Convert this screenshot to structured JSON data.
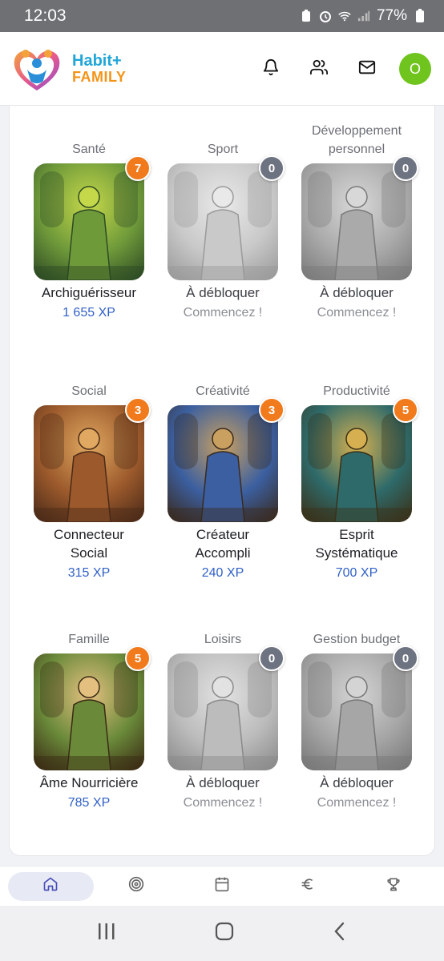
{
  "status_bar": {
    "time": "12:03",
    "battery": "77%"
  },
  "brand": {
    "top": "Habit+",
    "bottom": "FAMILY"
  },
  "user": {
    "avatar_initial": "O"
  },
  "categories": [
    {
      "category": "Santé",
      "title": "Archiguérisseur",
      "badge": "7",
      "xp": "1 655 XP",
      "cta": "",
      "locked": false
    },
    {
      "category": "Sport",
      "title": "À débloquer",
      "badge": "0",
      "xp": "",
      "cta": "Commencez !",
      "locked": true
    },
    {
      "category": "Développement personnel",
      "title": "À débloquer",
      "badge": "0",
      "xp": "",
      "cta": "Commencez !",
      "locked": true
    },
    {
      "category": "Social",
      "title": "Connecteur Social",
      "badge": "3",
      "xp": "315 XP",
      "cta": "",
      "locked": false
    },
    {
      "category": "Créativité",
      "title": "Créateur Accompli",
      "badge": "3",
      "xp": "240 XP",
      "cta": "",
      "locked": false
    },
    {
      "category": "Productivité",
      "title": "Esprit Systématique",
      "badge": "5",
      "xp": "700 XP",
      "cta": "",
      "locked": false
    },
    {
      "category": "Famille",
      "title": "Âme Nourricière",
      "badge": "5",
      "xp": "785 XP",
      "cta": "",
      "locked": false
    },
    {
      "category": "Loisirs",
      "title": "À débloquer",
      "badge": "0",
      "xp": "",
      "cta": "Commencez !",
      "locked": true
    },
    {
      "category": "Gestion budget",
      "title": "À débloquer",
      "badge": "0",
      "xp": "",
      "cta": "Commencez !",
      "locked": true
    }
  ],
  "bottom_nav": [
    {
      "icon": "home-icon",
      "active": true
    },
    {
      "icon": "target-icon",
      "active": false
    },
    {
      "icon": "calendar-icon",
      "active": false
    },
    {
      "icon": "euro-icon",
      "active": false
    },
    {
      "icon": "trophy-icon",
      "active": false
    }
  ],
  "colors": {
    "accent_orange": "#f07a1c",
    "xp_blue": "#2f5fc6",
    "brand_blue": "#21a6d8",
    "brand_orange": "#f39418",
    "avatar_green": "#6fc41d"
  }
}
